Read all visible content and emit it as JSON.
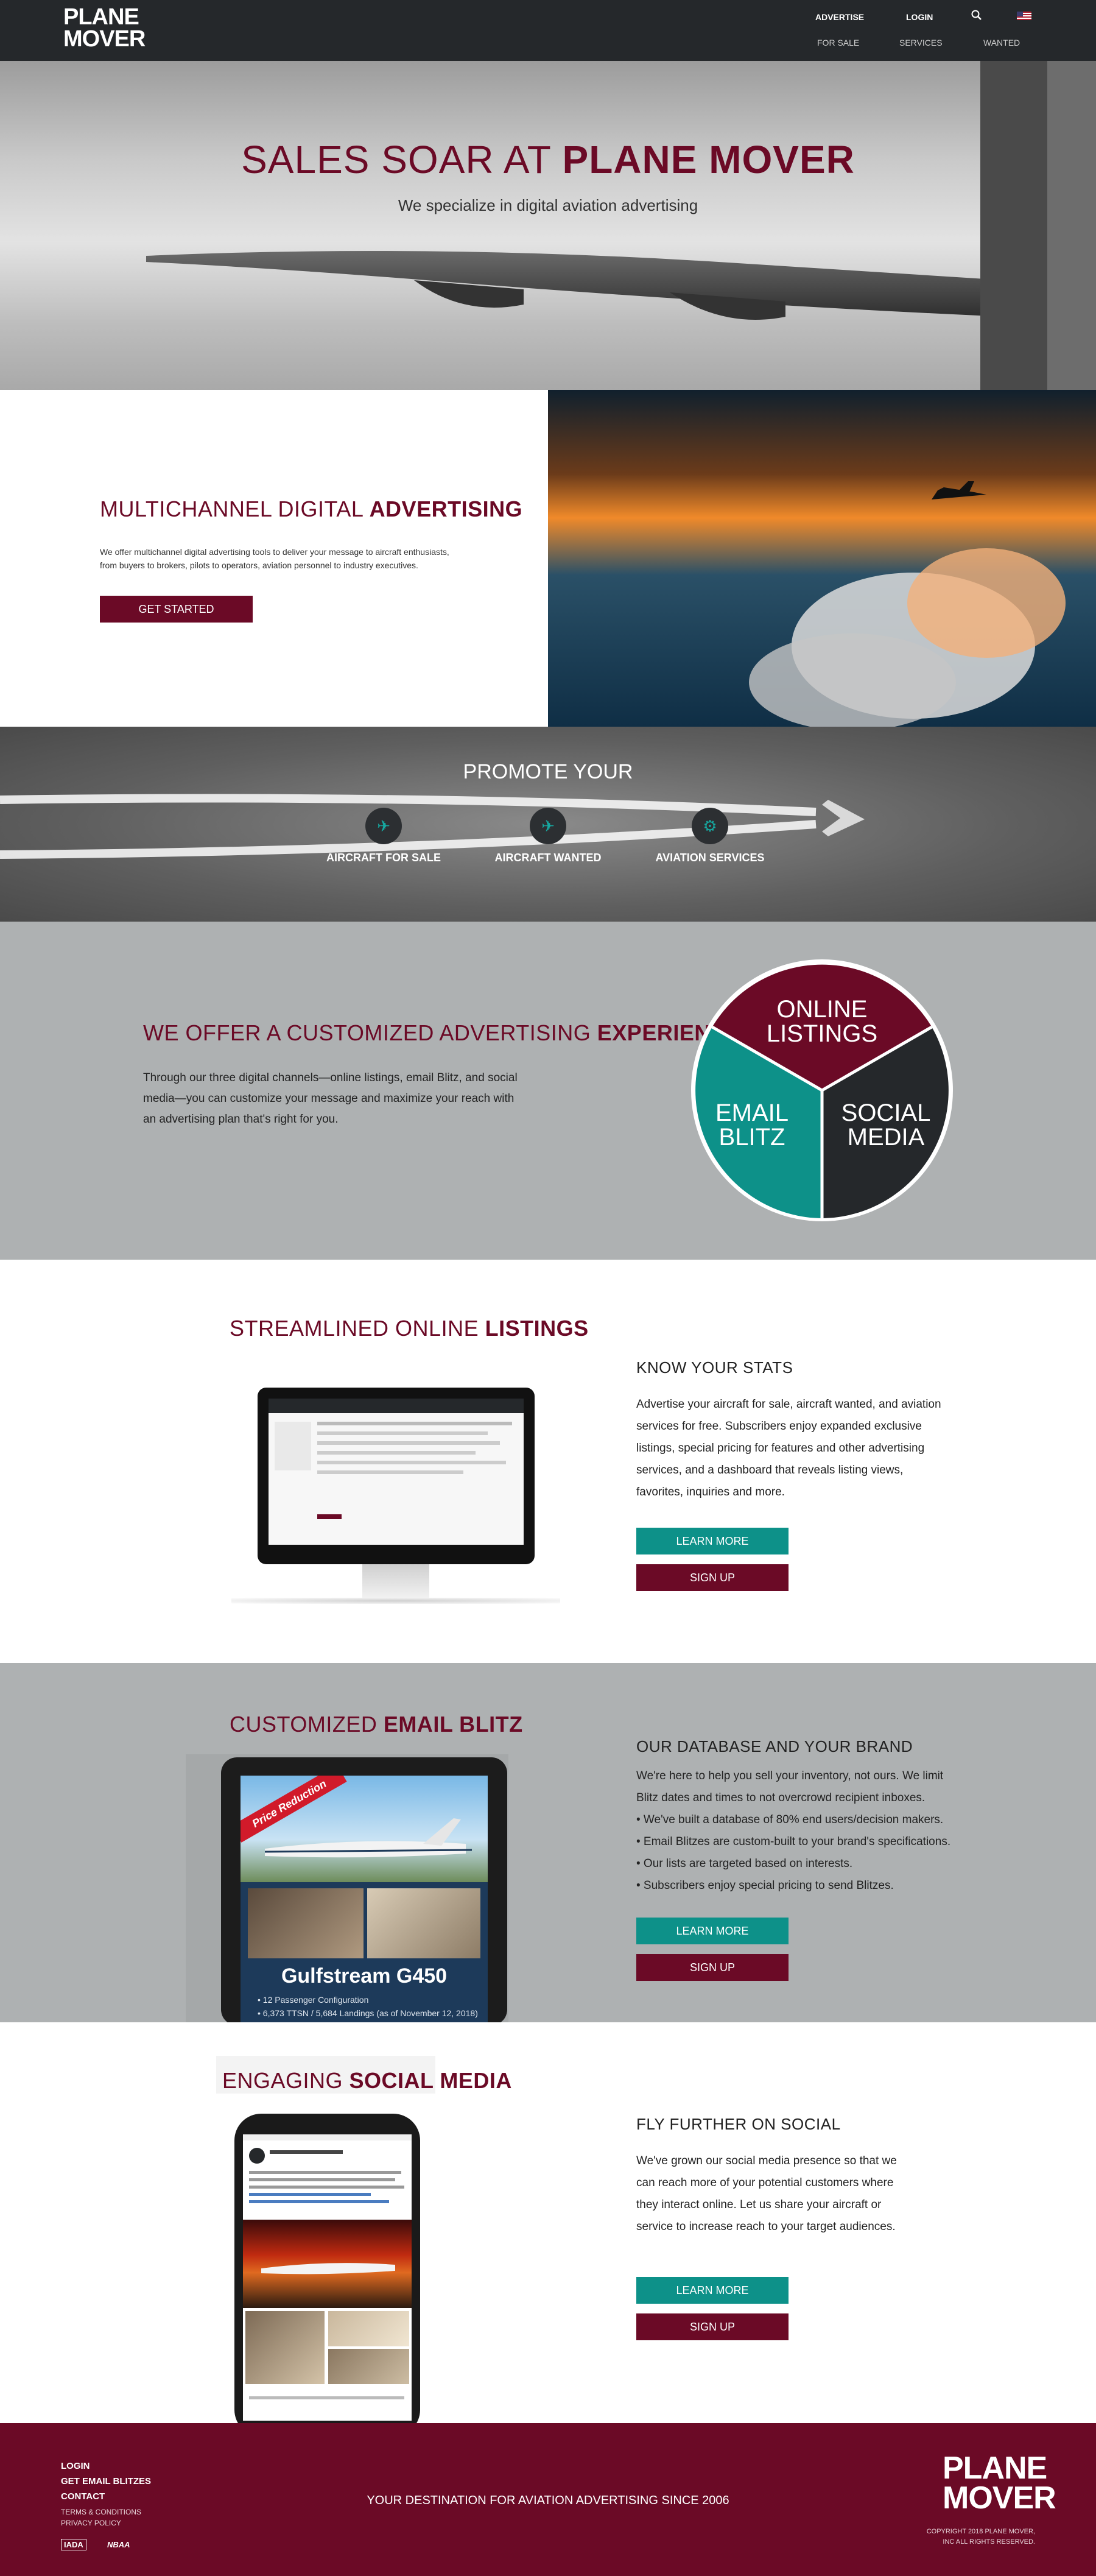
{
  "nav": {
    "logo_line1": "PLANE",
    "logo_line2": "MOVER",
    "top_links": [
      "ADVERTISE",
      "LOGIN"
    ],
    "bottom_links": [
      "FOR SALE",
      "SERVICES",
      "WANTED"
    ]
  },
  "hero": {
    "title_light": "SALES SOAR AT ",
    "title_bold": "PLANE MOVER",
    "subtitle": "We specialize in digital aviation advertising"
  },
  "multichannel": {
    "title_light": "MULTICHANNEL DIGITAL ",
    "title_bold": "ADVERTISING",
    "body": "We offer multichannel digital advertising tools to deliver your message to aircraft enthusiasts, from buyers to brokers, pilots to operators, aviation personnel to industry executives.",
    "button": "GET STARTED"
  },
  "promote": {
    "title": "PROMOTE YOUR",
    "items": [
      {
        "label": "AIRCRAFT FOR SALE",
        "icon": "airplane-icon"
      },
      {
        "label": "AIRCRAFT WANTED",
        "icon": "airplane-wanted-icon"
      },
      {
        "label": "AVIATION SERVICES",
        "icon": "services-gear-icon"
      }
    ]
  },
  "offer": {
    "title_light": "WE OFFER A CUSTOMIZED ADVERTISING ",
    "title_bold": "EXPERIENCE",
    "body": "Through our three digital channels—online listings, email Blitz, and social media—you can customize your message and maximize your reach with an advertising plan that's right for you.",
    "pie": {
      "top_line1": "ONLINE",
      "top_line2": "LISTINGS",
      "left_line1": "EMAIL",
      "left_line2": "BLITZ",
      "right_line1": "SOCIAL",
      "right_line2": "MEDIA"
    }
  },
  "listings": {
    "title_light": "STREAMLINED ONLINE ",
    "title_bold": "LISTINGS",
    "heading": "KNOW YOUR STATS",
    "body": "Advertise your aircraft for sale, aircraft wanted, and aviation services for free. Subscribers enjoy expanded exclusive listings, special pricing for features and other advertising services, and a dashboard that reveals listing views, favorites, inquiries and more.",
    "learn_more": "LEARN MORE",
    "sign_up": "SIGN UP"
  },
  "blitz": {
    "title_light": "CUSTOMIZED ",
    "title_bold": "EMAIL BLITZ",
    "heading": "OUR DATABASE AND YOUR BRAND",
    "body": "We're here to help you sell your inventory, not ours. We limit Blitz dates and times to not overcrowd recipient inboxes.",
    "bullets": [
      "• We've built a database of 80% end users/decision makers.",
      "• Email Blitzes are custom-built to your brand's specifications.",
      "• Our lists are targeted based on interests.",
      "• Subscribers enjoy special pricing to send Blitzes."
    ],
    "tablet_banner": "Price Reduction",
    "tablet_model": "Gulfstream G450",
    "tablet_specs": [
      "• 12 Passenger Configuration",
      "• 6,373 TTSN / 5,684 Landings (as of November 12, 2018)"
    ],
    "learn_more": "LEARN MORE",
    "sign_up": "SIGN UP"
  },
  "social": {
    "title_light": "ENGAGING ",
    "title_bold": "SOCIAL MEDIA",
    "heading": "FLY FURTHER ON SOCIAL",
    "body": "We've grown our social media presence so that we can reach more of your potential customers where they interact online. Let us share your aircraft or service to increase reach to your target audiences.",
    "learn_more": "LEARN MORE",
    "sign_up": "SIGN UP"
  },
  "footer": {
    "links": [
      "LOGIN",
      "GET EMAIL BLITZES",
      "CONTACT"
    ],
    "small_links": [
      "TERMS & CONDITIONS",
      "PRIVACY POLICY"
    ],
    "badges": [
      "IADA",
      "NBAA"
    ],
    "tagline": "YOUR DESTINATION FOR AVIATION ADVERTISING SINCE 2006",
    "logo_line1": "PLANE",
    "logo_line2": "MOVER",
    "copyright1": "COPYRIGHT 2018 PLANE MOVER,",
    "copyright2": "INC ALL RIGHTS RESERVED."
  },
  "colors": {
    "maroon": "#6b0a26",
    "teal": "#0d9189",
    "dark": "#25282b",
    "gray": "#aeb1b2"
  }
}
